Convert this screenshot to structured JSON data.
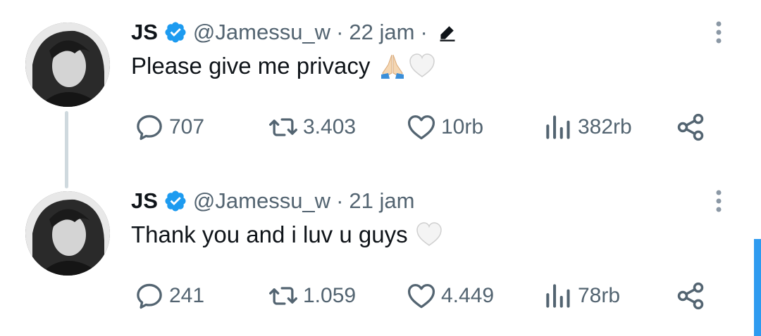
{
  "colors": {
    "text_primary": "#0f1419",
    "text_secondary": "#536471",
    "verified_blue": "#1d9bf0",
    "thread_line": "#cfd9de",
    "scrollbar": "#2e9bf0"
  },
  "tweets": [
    {
      "name": "JS",
      "handle": "@Jamessu_w",
      "separator": "·",
      "time": "22 jam",
      "time_suffix_separator": "·",
      "edited": true,
      "text": "Please give me privacy",
      "emojis": [
        "folded-hands",
        "white-heart"
      ],
      "stats": {
        "replies": "707",
        "retweets": "3.403",
        "likes": "10rb",
        "views": "382rb"
      }
    },
    {
      "name": "JS",
      "handle": "@Jamessu_w",
      "separator": "·",
      "time": "21 jam",
      "edited": false,
      "text": "Thank you and i luv u guys",
      "emojis": [
        "white-heart"
      ],
      "stats": {
        "replies": "241",
        "retweets": "1.059",
        "likes": "4.449",
        "views": "78rb"
      }
    }
  ]
}
